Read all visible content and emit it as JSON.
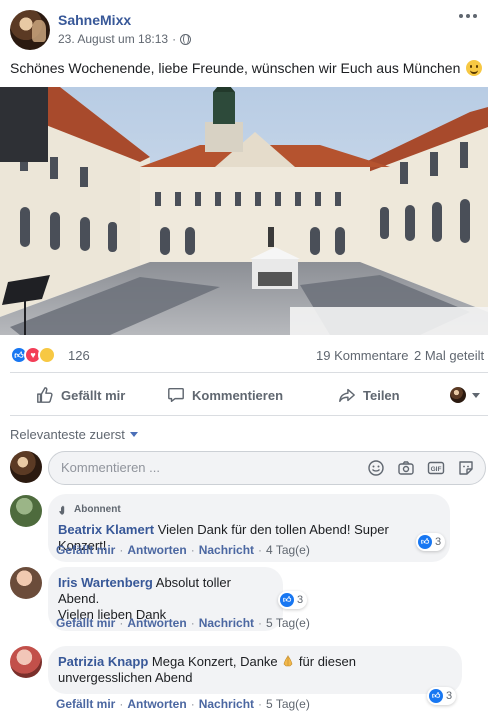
{
  "post": {
    "author": "SahneMixx",
    "date": "23. August um 18:13",
    "date_sep": "·",
    "text": "Schönes Wochenende, liebe Freunde, wünschen wir Euch aus München"
  },
  "stats": {
    "reactions": "126",
    "comments": "19 Kommentare",
    "shares": "2 Mal geteilt"
  },
  "actions": {
    "like": "Gefällt mir",
    "comment": "Kommentieren",
    "share": "Teilen"
  },
  "sort_label": "Relevanteste zuerst",
  "composer": {
    "placeholder": "Kommentieren ..."
  },
  "comments": [
    {
      "badge": "Abonnent",
      "name": "Beatrix Klamert",
      "text": "Vielen Dank für den tollen Abend! Super Konzert!",
      "like": "Gefällt mir",
      "reply": "Antworten",
      "translate": "Nachricht",
      "time": "4 Tag(e)",
      "reactions": "3"
    },
    {
      "name": "Iris Wartenberg",
      "text_line1": "Absolut toller Abend.",
      "text_line2": "Vielen lieben Dank",
      "like": "Gefällt mir",
      "reply": "Antworten",
      "translate": "Nachricht",
      "time": "5 Tag(e)",
      "reactions": "3"
    },
    {
      "name": "Patrizia Knapp",
      "text_line1a": "Mega Konzert, Danke",
      "text_line1b": "für diesen",
      "text_line2": "unvergesslichen Abend",
      "like": "Gefällt mir",
      "reply": "Antworten",
      "translate": "Nachricht",
      "time": "5 Tag(e)",
      "reactions": "3"
    }
  ],
  "colors": {
    "link_blue": "#385898",
    "like_blue": "#1877f2",
    "love_red": "#f33e58",
    "wow_yellow": "#f7c843",
    "meta_gray": "#606770",
    "bubble_bg": "#f2f3f5"
  },
  "icons": [
    "globe-icon",
    "more-icon",
    "smile-emoji",
    "like-reaction-icon",
    "love-reaction-icon",
    "wow-reaction-icon",
    "thumbs-up-icon",
    "speech-bubble-icon",
    "share-arrow-icon",
    "caret-down-icon",
    "emoji-icon",
    "camera-icon",
    "gif-icon",
    "sticker-icon",
    "folded-hands-emoji"
  ]
}
